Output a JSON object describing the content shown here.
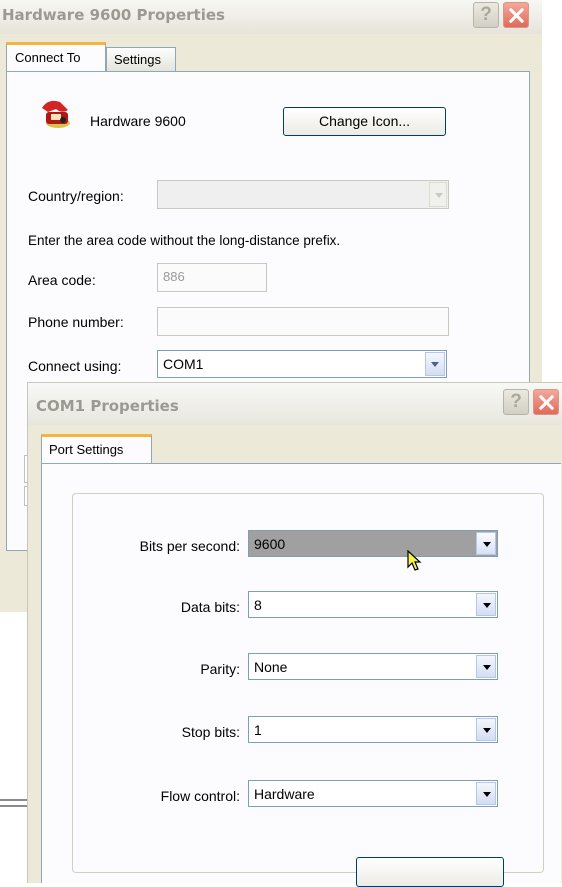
{
  "back_dialog": {
    "title": "Hardware 9600 Properties",
    "tabs": [
      {
        "label": "Connect To",
        "active": true
      },
      {
        "label": "Settings",
        "active": false
      }
    ],
    "entry_name": "Hardware 9600",
    "change_icon_label": "Change Icon...",
    "country_label": "Country/region:",
    "country_value": "",
    "area_hint": "Enter the area code without the long-distance prefix.",
    "area_code_label": "Area code:",
    "area_code_value": "886",
    "phone_label": "Phone number:",
    "phone_value": "",
    "connect_using_label": "Connect using:",
    "connect_using_value": "COM1",
    "help_glyph": "?"
  },
  "front_dialog": {
    "title": "COM1 Properties",
    "tab": "Port Settings",
    "help_glyph": "?",
    "fields": {
      "bits_per_second": {
        "label": "Bits per second:",
        "value": "9600"
      },
      "data_bits": {
        "label": "Data bits:",
        "value": "8"
      },
      "parity": {
        "label": "Parity:",
        "value": "None"
      },
      "stop_bits": {
        "label": "Stop bits:",
        "value": "1"
      },
      "flow_control": {
        "label": "Flow control:",
        "value": "Hardware"
      }
    }
  },
  "colors": {
    "tab_accent": "#f4b63a",
    "close_button": "#e06a5a",
    "dialog_face": "#ece9d8",
    "selection": "#a0a0a0"
  },
  "icons": [
    "phone-icon",
    "help-icon",
    "close-icon",
    "chevron-down-icon",
    "mouse-cursor-icon"
  ]
}
